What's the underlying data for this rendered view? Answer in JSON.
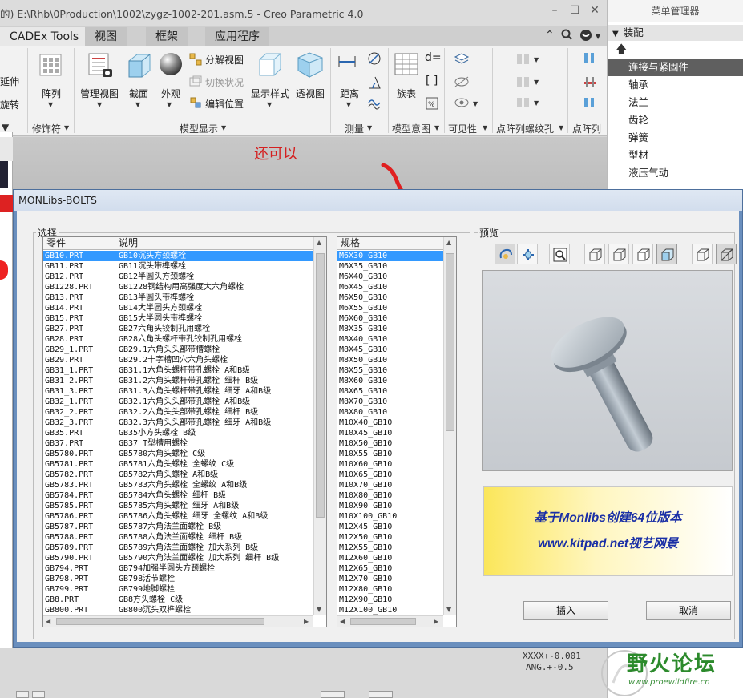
{
  "window": {
    "title": "的) E:\\Rhb\\0Production\\1002\\zygz-1002-201.asm.5 - Creo Parametric 4.0"
  },
  "ribbon_tabs": [
    "CADEx Tools",
    "视图",
    "框架",
    "应用程序"
  ],
  "ribbon": {
    "left_partial": [
      "延伸",
      "旋转"
    ],
    "left_group_partial": "▼",
    "array_label": "阵列",
    "modifier_group": "修饰符",
    "manage_view": "管理视图",
    "section": "截面",
    "appearance": "外观",
    "explode_view": "分解视图",
    "toggle_state": "切换状况",
    "edit_position": "编辑位置",
    "display_style": "显示样式",
    "perspective": "透视图",
    "model_display_group": "模型显示",
    "distance": "距离",
    "measure_group": "测量",
    "family_table": "族表",
    "model_intent_group": "模型意图",
    "visibility_group": "可见性",
    "point_array_group": "点阵列螺纹孔",
    "point_array_group2": "点阵列"
  },
  "annotation": "还可以",
  "menu_manager": {
    "title": "菜单管理器",
    "header": "装配",
    "items": [
      "连接与紧固件",
      "轴承",
      "法兰",
      "齿轮",
      "弹簧",
      "型材",
      "液压气动"
    ],
    "selected_index": 0
  },
  "dialog": {
    "title": "MONLibs-BOLTS",
    "select_group": "选择",
    "preview_group": "预览",
    "parts_headers": [
      "零件",
      "说明"
    ],
    "parts": [
      [
        "GB10.PRT",
        "GB10沉头方颈螺栓"
      ],
      [
        "GB11.PRT",
        "GB11沉头带榫螺栓"
      ],
      [
        "GB12.PRT",
        "GB12半圆头方颈螺栓"
      ],
      [
        "GB1228.PRT",
        "GB1228钢结构用高强度大六角螺栓"
      ],
      [
        "GB13.PRT",
        "GB13半圆头带榫螺栓"
      ],
      [
        "GB14.PRT",
        "GB14大半圆头方颈螺栓"
      ],
      [
        "GB15.PRT",
        "GB15大半圆头带榫螺栓"
      ],
      [
        "GB27.PRT",
        "GB27六角头铰制孔用螺栓"
      ],
      [
        "GB28.PRT",
        "GB28六角头螺杆带孔铰制孔用螺栓"
      ],
      [
        "GB29_1.PRT",
        "GB29.1六角头头部带槽螺栓"
      ],
      [
        "GB29.PRT",
        "GB29.2十字槽凹穴六角头螺栓"
      ],
      [
        "GB31_1.PRT",
        "GB31.1六角头螺杆带孔螺栓  A和B级"
      ],
      [
        "GB31_2.PRT",
        "GB31.2六角头螺杆带孔螺栓  细杆  B级"
      ],
      [
        "GB31_3.PRT",
        "GB31.3六角头螺杆带孔螺栓  细牙  A和B级"
      ],
      [
        "GB32_1.PRT",
        "GB32.1六角头头部带孔螺栓  A和B级"
      ],
      [
        "GB32_2.PRT",
        "GB32.2六角头头部带孔螺栓  细杆  B级"
      ],
      [
        "GB32_3.PRT",
        "GB32.3六角头头部带孔螺栓  细牙  A和B级"
      ],
      [
        "GB35.PRT",
        "GB35小方头螺栓  B级"
      ],
      [
        "GB37.PRT",
        "GB37 T型槽用螺栓"
      ],
      [
        "GB5780.PRT",
        "GB5780六角头螺栓  C级"
      ],
      [
        "GB5781.PRT",
        "GB5781六角头螺栓  全螺纹  C级"
      ],
      [
        "GB5782.PRT",
        "GB5782六角头螺栓  A和B级"
      ],
      [
        "GB5783.PRT",
        "GB5783六角头螺栓  全螺纹  A和B级"
      ],
      [
        "GB5784.PRT",
        "GB5784六角头螺栓  细杆  B级"
      ],
      [
        "GB5785.PRT",
        "GB5785六角头螺栓  细牙  A和B级"
      ],
      [
        "GB5786.PRT",
        "GB5786六角头螺栓  细牙  全螺纹  A和B级"
      ],
      [
        "GB5787.PRT",
        "GB5787六角法兰面螺栓  B级"
      ],
      [
        "GB5788.PRT",
        "GB5788六角法兰面螺栓  细杆  B级"
      ],
      [
        "GB5789.PRT",
        "GB5789六角法兰面螺栓  加大系列  B级"
      ],
      [
        "GB5790.PRT",
        "GB5790六角法兰面螺栓  加大系列  细杆  B级"
      ],
      [
        "GB794.PRT",
        "GB794加强半圆头方颈螺栓"
      ],
      [
        "GB798.PRT",
        "GB798活节螺栓"
      ],
      [
        "GB799.PRT",
        "GB799地脚螺栓"
      ],
      [
        "GB8.PRT",
        "GB8方头螺栓  C级"
      ],
      [
        "GB800.PRT",
        "GB800沉头双榫螺栓"
      ]
    ],
    "selected_part_index": 0,
    "spec_header": "规格",
    "specs": [
      "M6X30_GB10",
      "M6X35_GB10",
      "M6X40_GB10",
      "M6X45_GB10",
      "M6X50_GB10",
      "M6X55_GB10",
      "M6X60_GB10",
      "M8X35_GB10",
      "M8X40_GB10",
      "M8X45_GB10",
      "M8X50_GB10",
      "M8X55_GB10",
      "M8X60_GB10",
      "M8X65_GB10",
      "M8X70_GB10",
      "M8X80_GB10",
      "M10X40_GB10",
      "M10X45_GB10",
      "M10X50_GB10",
      "M10X55_GB10",
      "M10X60_GB10",
      "M10X65_GB10",
      "M10X70_GB10",
      "M10X80_GB10",
      "M10X90_GB10",
      "M10X100_GB10",
      "M12X45_GB10",
      "M12X50_GB10",
      "M12X55_GB10",
      "M12X60_GB10",
      "M12X65_GB10",
      "M12X70_GB10",
      "M12X80_GB10",
      "M12X90_GB10",
      "M12X100_GB10"
    ],
    "selected_spec_index": 0,
    "banner_line1": "基于Monlibs创建64位版本",
    "banner_line2": "www.kitpad.net视艺网景",
    "insert_button": "插入",
    "cancel_button": "取消"
  },
  "status": {
    "line1": "XXXX+-0.001",
    "line2": "ANG.+-0.5"
  },
  "watermark": {
    "text": "野火论坛",
    "url": "www.proewildfire.cn"
  },
  "colors": {
    "selection": "#3399ff",
    "menu_selected": "#5f5f5f",
    "annotation": "#d42020",
    "banner_text": "#1a2fa6",
    "dialog_frame": "#6a8fbe"
  }
}
